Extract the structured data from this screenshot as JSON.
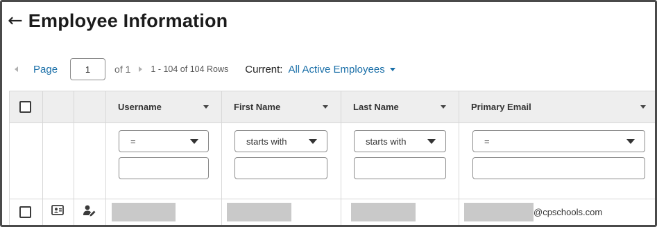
{
  "header": {
    "back_icon": "arrow-left-icon",
    "title": "Employee Information"
  },
  "pager": {
    "page_label": "Page",
    "current_page": "1",
    "of_text": "of 1",
    "rows_text": "1 - 104 of 104 Rows",
    "current_label": "Current:",
    "current_value": "All Active Employees"
  },
  "grid": {
    "columns": [
      {
        "label": "Username",
        "operator": "="
      },
      {
        "label": "First Name",
        "operator": "starts with"
      },
      {
        "label": "Last Name",
        "operator": "starts with"
      },
      {
        "label": "Primary Email",
        "operator": "="
      }
    ],
    "row_icons": [
      "id-card-icon",
      "user-edit-icon"
    ],
    "first_row": {
      "username": "",
      "first_name": "",
      "last_name": "",
      "primary_email_visible": "@cpschools.com"
    }
  },
  "colors": {
    "link": "#1a6fa8",
    "header_bg": "#eeeeee",
    "redaction": "#c9c9c9"
  }
}
